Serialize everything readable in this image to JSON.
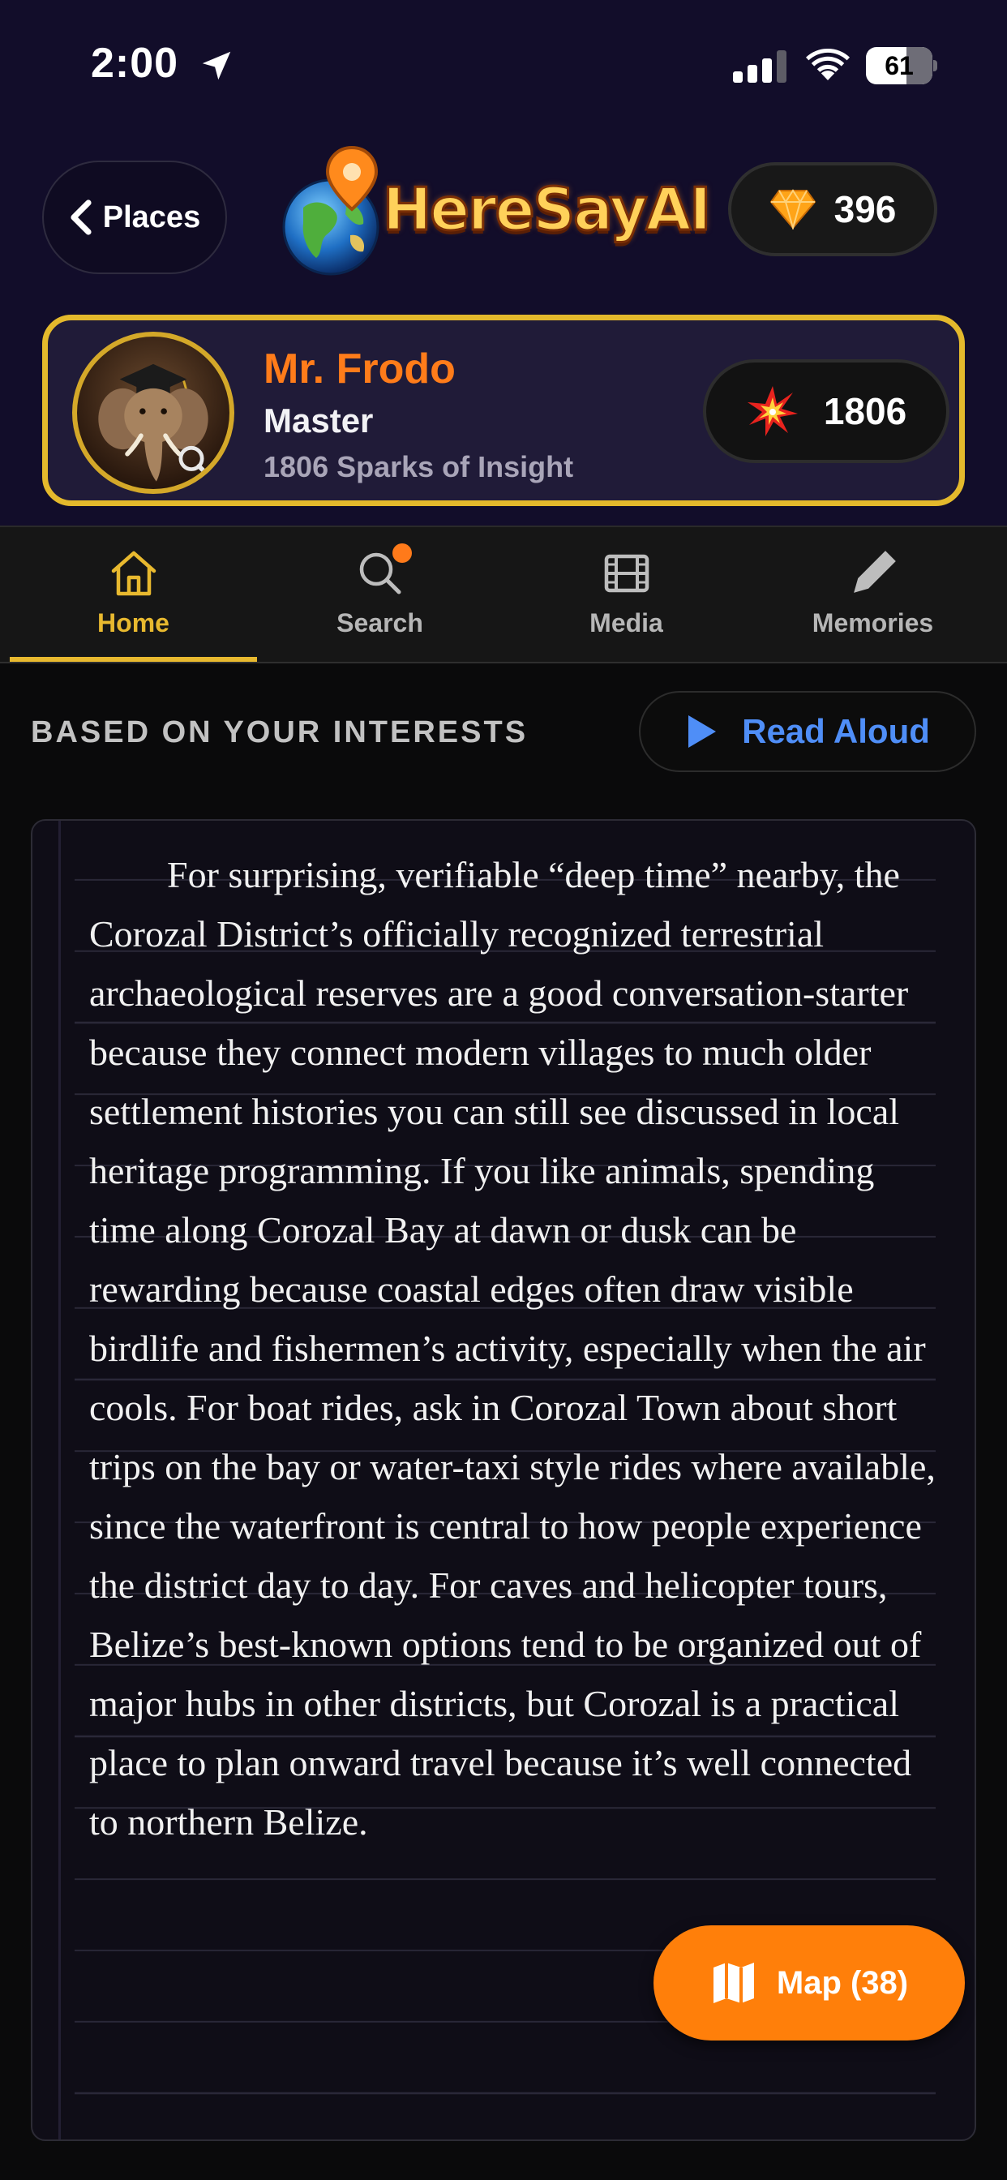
{
  "status_bar": {
    "time": "2:00",
    "battery_level": "61"
  },
  "header": {
    "back_label": "Places",
    "app_name": "HereSayAI",
    "gems": "396"
  },
  "profile": {
    "name": "Mr. Frodo",
    "rank": "Master",
    "sparks_text": "1806 Sparks of Insight",
    "sparks": "1806"
  },
  "tabs": [
    {
      "label": "Home",
      "icon": "home-icon",
      "active": true
    },
    {
      "label": "Search",
      "icon": "search-icon",
      "badge": true
    },
    {
      "label": "Media",
      "icon": "film-icon"
    },
    {
      "label": "Memories",
      "icon": "pencil-icon"
    }
  ],
  "content": {
    "heading": "BASED ON YOUR INTERESTS",
    "read_aloud_label": "Read Aloud",
    "article": "For surprising, verifiable “deep time” nearby, the Corozal District’s officially recognized terrestrial archaeological reserves are a good conversation-starter because they connect modern villages to much older settlement histories you can still see discussed in local heritage programming. If you like animals, spending time along Corozal Bay at dawn or dusk can be rewarding because coastal edges often draw visible birdlife and fishermen’s activity, especially when the air cools. For boat rides, ask in Corozal Town about short trips on the bay or water-taxi style rides where available, since the waterfront is central to how people experience the district day to day. For caves and helicopter tours, Belize’s best-known options tend to be organized out of major hubs in other districts, but Corozal is a practical place to plan onward travel because it’s well connected to northern Belize."
  },
  "map_button": {
    "label": "Map (38)"
  },
  "colors": {
    "header_bg": "#120d2a",
    "accent_gold": "#e8b92f",
    "accent_orange": "#ff7f0a",
    "name_orange": "#ff7c1a",
    "link_blue": "#4f8ef7"
  }
}
